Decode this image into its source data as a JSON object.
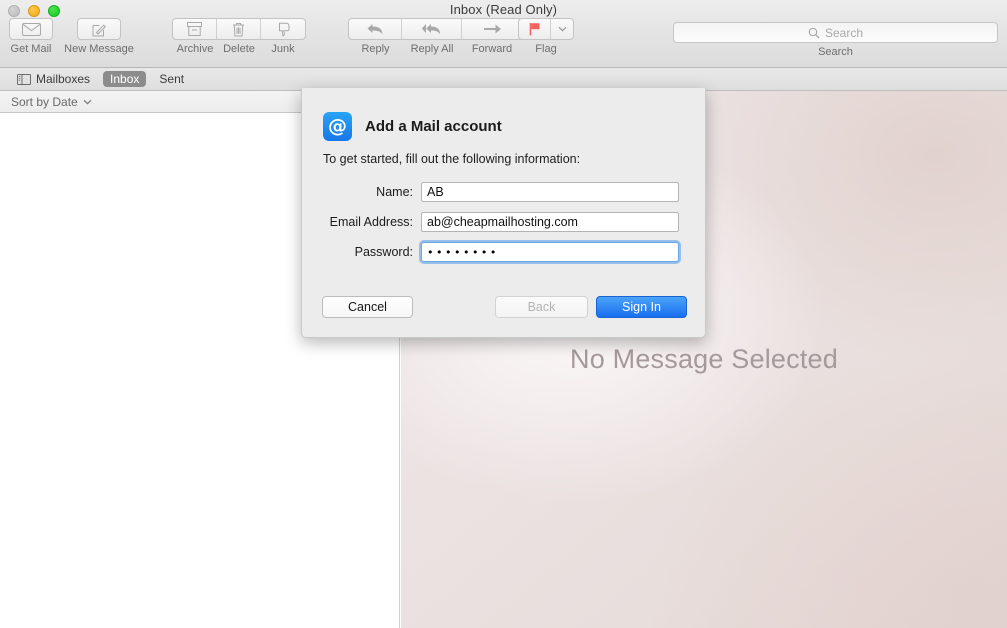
{
  "window": {
    "title": "Inbox (Read Only)",
    "traffic_lights": [
      "close",
      "minimize",
      "maximize"
    ]
  },
  "toolbar": {
    "buttons": [
      {
        "label": "Get Mail",
        "icon": "envelope-icon"
      },
      {
        "label": "New Message",
        "icon": "compose-icon"
      }
    ],
    "segment_group": [
      {
        "label": "Archive",
        "icon": "archive-box-icon"
      },
      {
        "label": "Delete",
        "icon": "trash-icon"
      },
      {
        "label": "Junk",
        "icon": "thumbs-down-icon"
      }
    ],
    "reply_group": [
      {
        "label": "Reply",
        "icon": "reply-arrow-icon"
      },
      {
        "label": "Reply All",
        "icon": "reply-all-arrow-icon"
      },
      {
        "label": "Forward",
        "icon": "forward-arrow-icon"
      }
    ],
    "flag": {
      "label": "Flag",
      "icon": "flag-icon",
      "color": "#f4635e",
      "menu_icon": "chevron-down-icon"
    }
  },
  "search": {
    "placeholder": "Search",
    "value": "",
    "label": "Search",
    "icon": "search-icon"
  },
  "favorites_bar": {
    "mailboxes": {
      "label": "Mailboxes",
      "icon": "sidebar-panel-icon"
    },
    "items": [
      {
        "label": "Inbox",
        "selected": true
      },
      {
        "label": "Sent",
        "selected": false
      }
    ]
  },
  "message_list": {
    "sort_label": "Sort by Date",
    "sort_icon": "chevron-down-icon",
    "messages": []
  },
  "reading_pane": {
    "empty_text": "No Message Selected"
  },
  "sheet": {
    "icon": "at-sign-icon",
    "title": "Add a Mail account",
    "subtitle": "To get started, fill out the following information:",
    "fields": [
      {
        "label": "Name:",
        "value": "AB",
        "type": "text",
        "focused": false
      },
      {
        "label": "Email Address:",
        "value": "ab@cheapmailhosting.com",
        "type": "text",
        "focused": false
      },
      {
        "label": "Password:",
        "value": "••••••••",
        "type": "password",
        "focused": true
      }
    ],
    "buttons": {
      "cancel": "Cancel",
      "back": "Back",
      "signin": "Sign In"
    }
  },
  "colors": {
    "accent_blue": "#1a6ff0",
    "selection_gray": "#8c8c8c",
    "flag_red": "#f4635e",
    "focus_ring": "#6ba7e8"
  }
}
